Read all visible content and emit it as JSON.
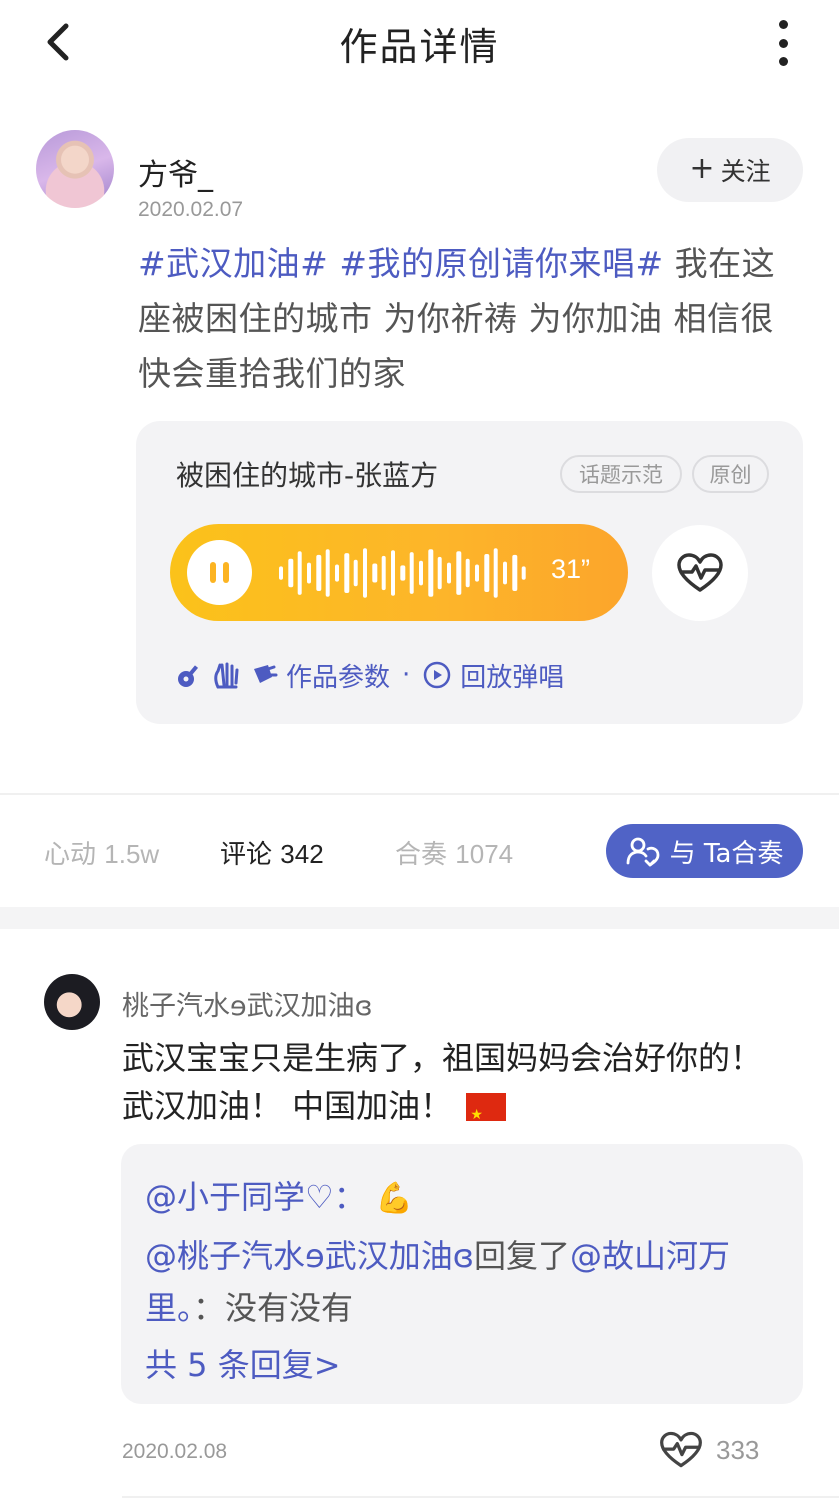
{
  "header": {
    "title": "作品详情"
  },
  "author": {
    "name": "方爷_",
    "date": "2020.02.07",
    "follow_label": "关注"
  },
  "post": {
    "hashtag_1": "#武汉加油#",
    "hashtag_2": "#我的原创请你来唱#",
    "body": "我在这座被困住的城市 为你祈祷 为你加油 相信很快会重拾我们的家"
  },
  "music_card": {
    "song_title": "被困住的城市-张蓝方",
    "tags": [
      "话题示范",
      "原创"
    ],
    "duration": "31”",
    "params_label": "作品参数",
    "separator": "·",
    "playback_label": "回放弹唱"
  },
  "stats": {
    "like_label": "心动",
    "like_count": "1.5w",
    "comment_label": "评论",
    "comment_count": "342",
    "chorus_label": "合奏",
    "chorus_count": "1074",
    "chorus_button": "与 Ta合奏"
  },
  "comment": {
    "user": "桃子汽水ɘ武汉加油ɞ",
    "text": "武汉宝宝只是生病了，祖国妈妈会治好你的！ 武汉加油！ 中国加油！",
    "replies": {
      "r1_user": "@小于同学♡：",
      "r2_user": "@桃子汽水ɘ武汉加油ɞ",
      "r2_mid": "回复了",
      "r2_target": "@故山河万里。",
      "r2_sep": "：",
      "r2_text": "没有没有",
      "more": "共 5 条回复>"
    },
    "date": "2020.02.08",
    "like_count": "333"
  },
  "colors": {
    "accent": "#4d5bc1",
    "button": "#5063c6",
    "player": "#fdb52a"
  },
  "icons": [
    "back-arrow-icon",
    "more-dots-icon",
    "plus-icon",
    "pause-icon",
    "heartbeat-icon",
    "guitar-icon",
    "hands-icon",
    "mic-icon",
    "replay-icon",
    "chorus-icon"
  ]
}
